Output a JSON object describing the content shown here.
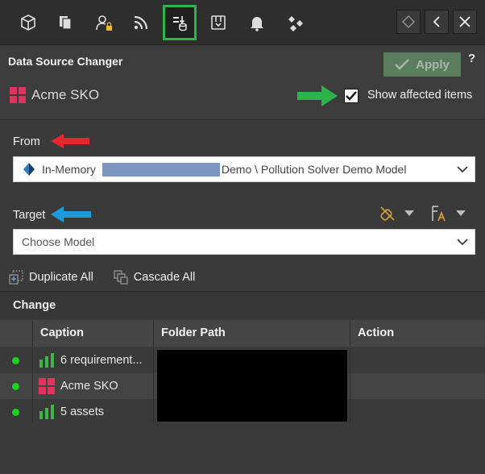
{
  "toolbar": {
    "icons": [
      "cube-icon",
      "copy-icon",
      "user-lock-icon",
      "rss-icon",
      "data-source-changer-icon",
      "archive-icon",
      "bell-icon",
      "relationship-icon"
    ],
    "window_buttons": [
      "diamond-icon",
      "back-icon",
      "close-icon"
    ]
  },
  "header": {
    "title": "Data Source Changer",
    "apply_label": "Apply",
    "help_label": "?",
    "model_name": "Acme SKO",
    "show_affected_label": "Show affected items",
    "show_affected_checked": true
  },
  "source": {
    "from_label": "From",
    "from_prefix": "In-Memory",
    "from_suffix": "Demo \\ Pollution Solver Demo Model",
    "target_label": "Target",
    "target_placeholder": "Choose Model"
  },
  "actions": {
    "duplicate_all": "Duplicate All",
    "cascade_all": "Cascade All"
  },
  "change": {
    "title": "Change",
    "columns": [
      "Caption",
      "Folder Path",
      "Action"
    ],
    "rows": [
      {
        "caption": "6 requirement...",
        "icon": "bar-chart-icon",
        "status": "green"
      },
      {
        "caption": "Acme SKO",
        "icon": "grid-icon",
        "status": "green"
      },
      {
        "caption": "5 assets",
        "icon": "bar-chart-icon",
        "status": "green"
      }
    ]
  },
  "colors": {
    "accent_green": "#2cb34a",
    "brand_pink": "#e0345f",
    "status_green": "#1fd11f",
    "arrow_red": "#e5272c",
    "arrow_blue": "#1d9bdb"
  }
}
